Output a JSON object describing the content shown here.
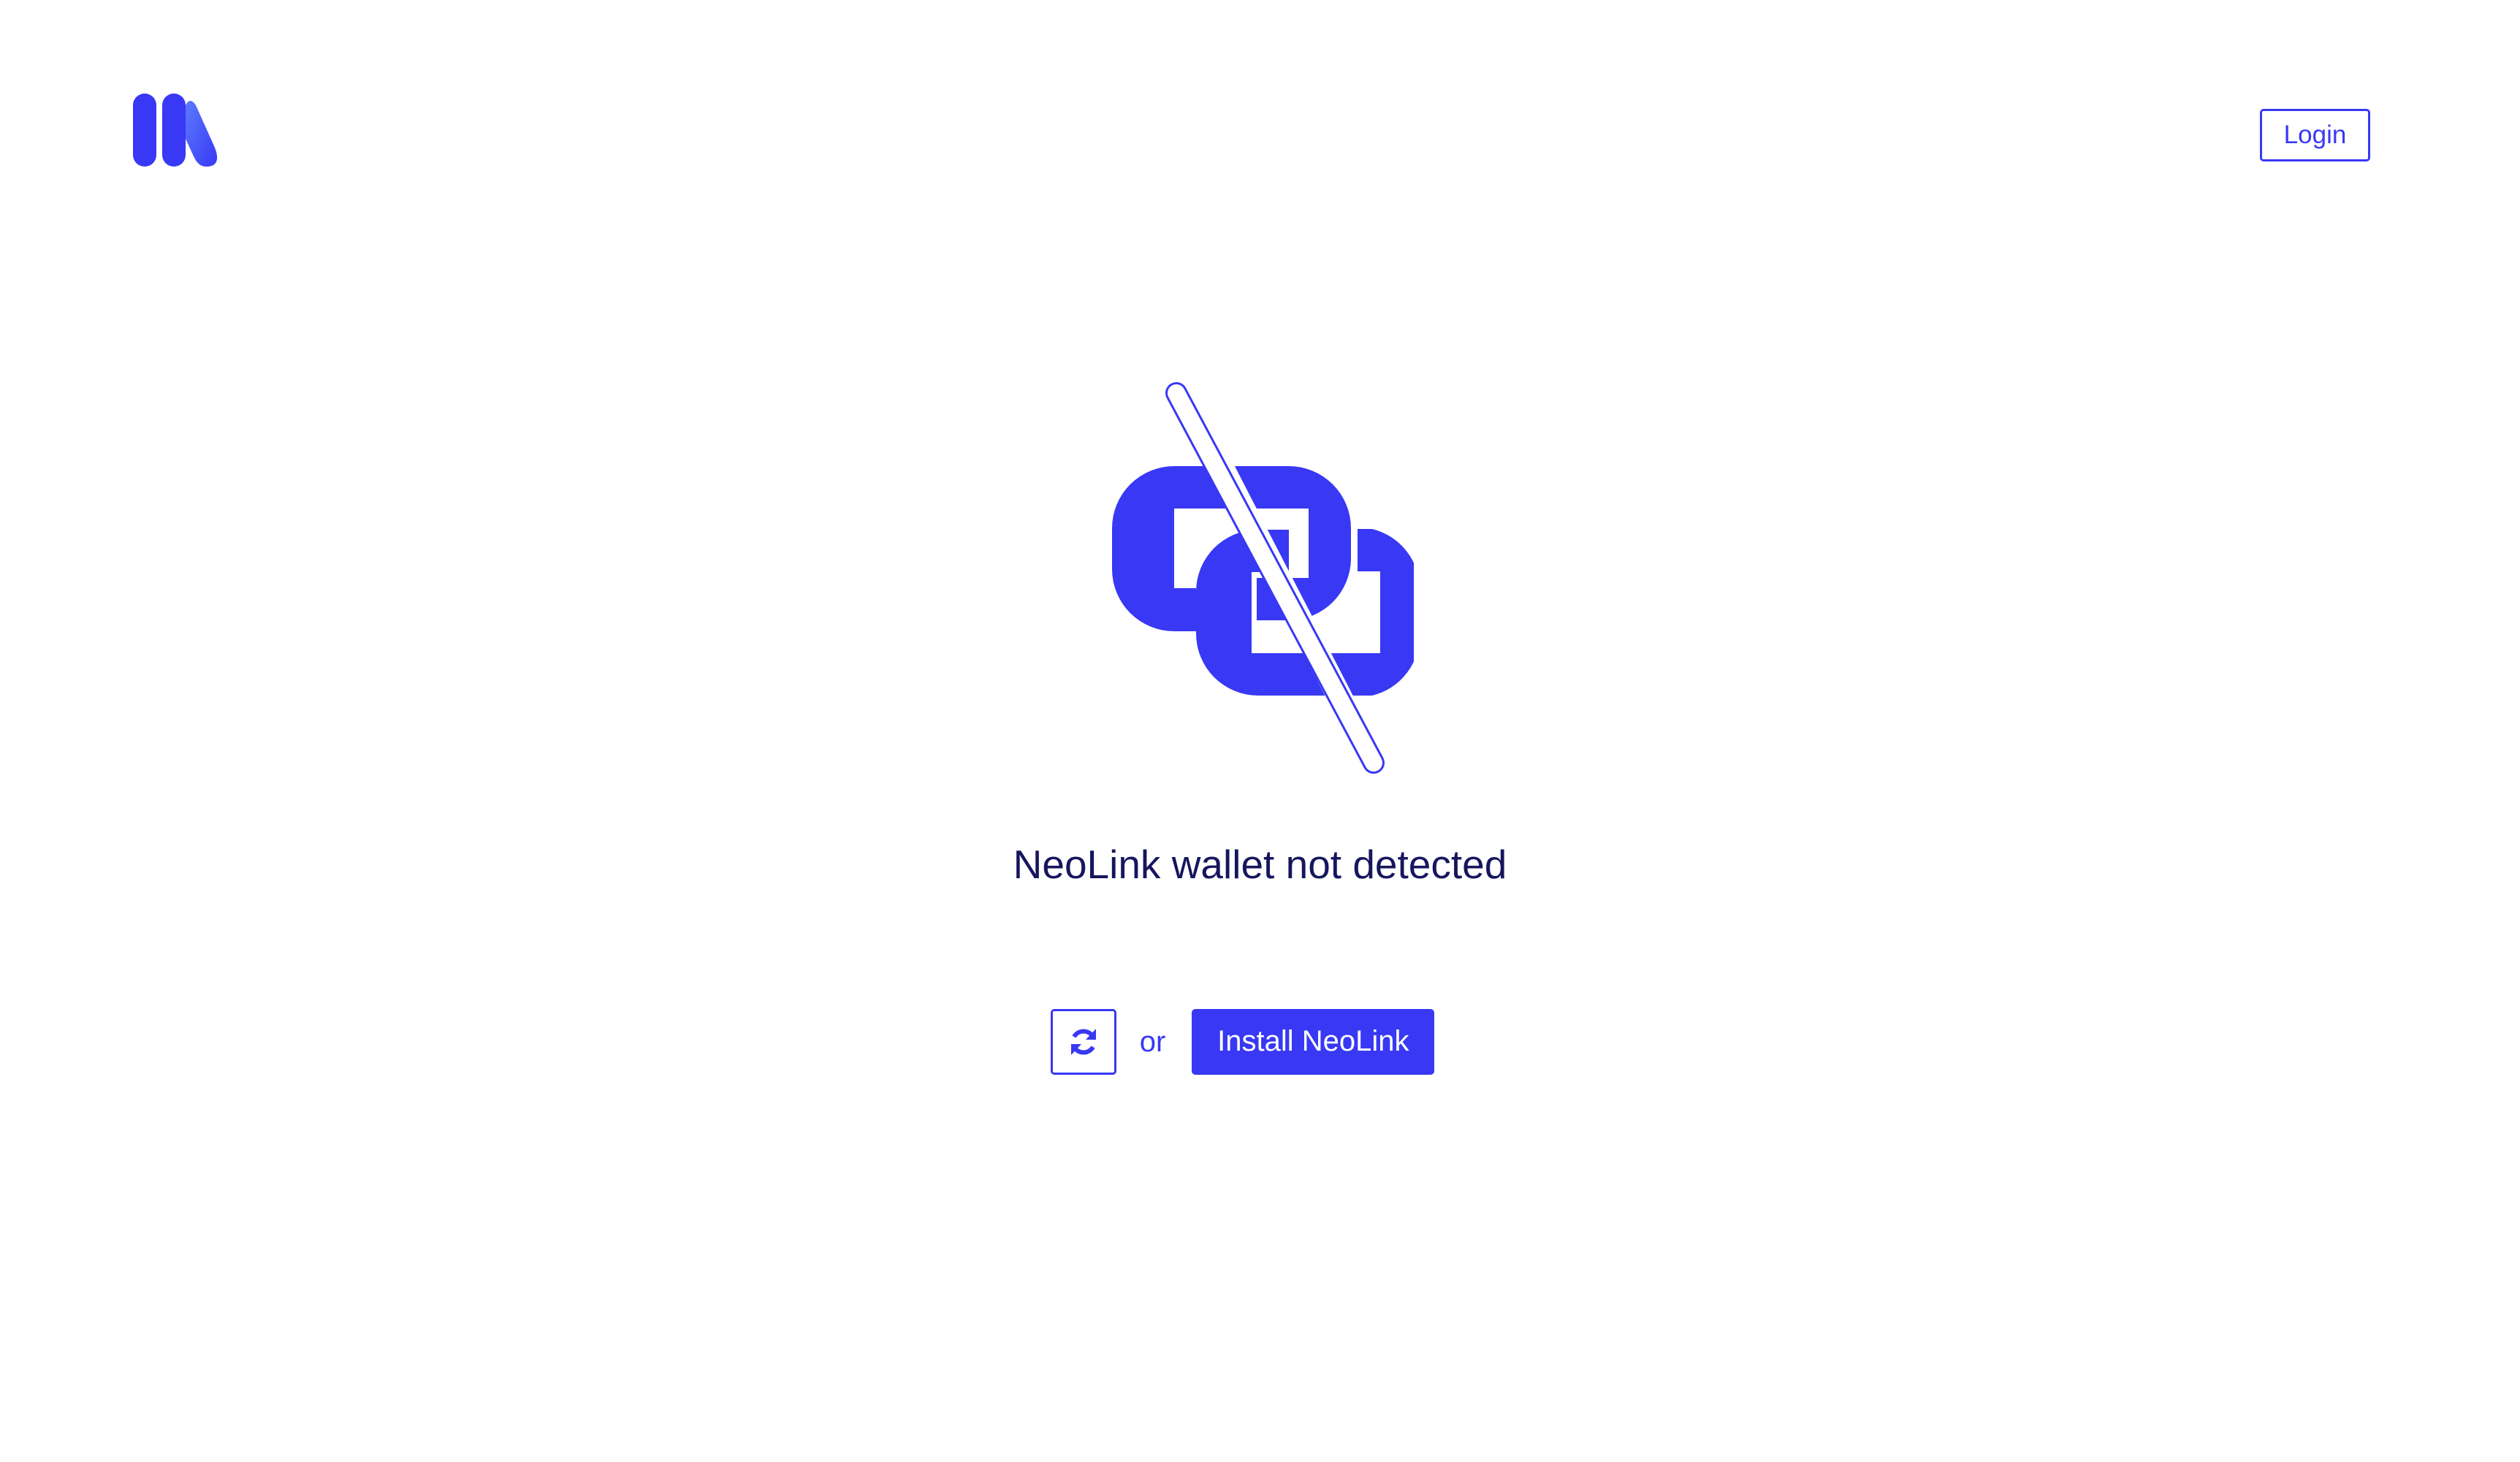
{
  "header": {
    "logo_icon": "brand-logo-icon",
    "login_label": "Login"
  },
  "main": {
    "illustration_icon": "broken-link-icon",
    "status_title": "NeoLink wallet not detected",
    "refresh_icon": "refresh-icon",
    "or_text": "or",
    "install_label": "Install NeoLink"
  },
  "colors": {
    "accent": "#3838f5",
    "title_text": "#16165e",
    "background": "#ffffff"
  }
}
